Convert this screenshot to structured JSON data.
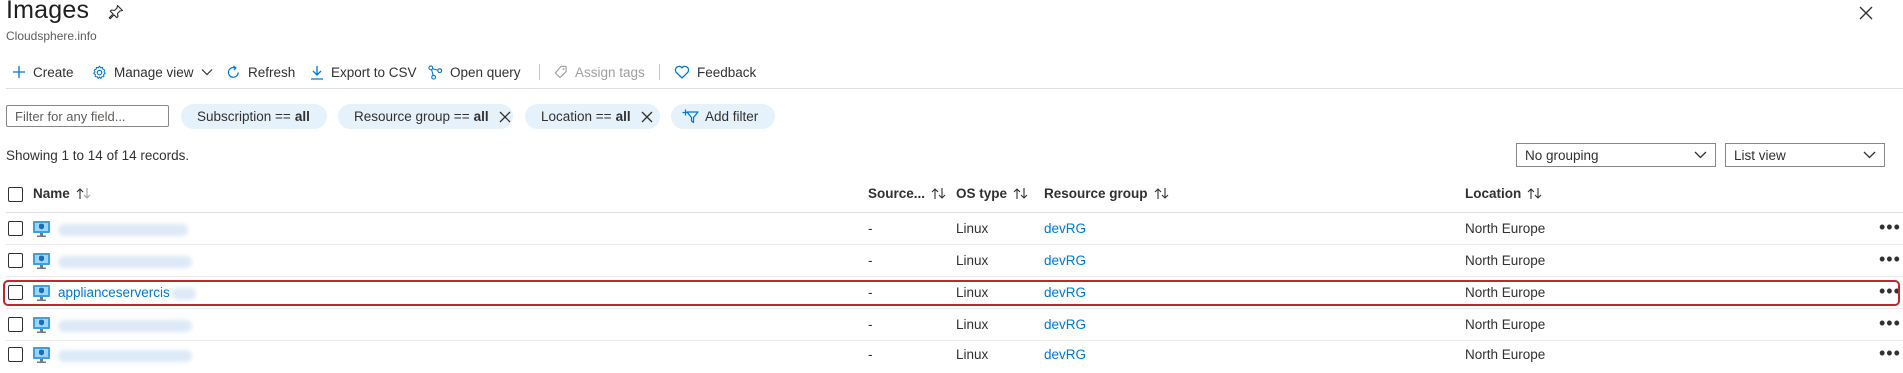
{
  "header": {
    "title": "Images",
    "subtitle": "Cloudsphere.info",
    "pin_icon": "pin-icon",
    "close_icon": "close-icon"
  },
  "toolbar": {
    "create": "Create",
    "manage_view": "Manage view",
    "refresh": "Refresh",
    "export_csv": "Export to CSV",
    "open_query": "Open query",
    "assign_tags": "Assign tags",
    "feedback": "Feedback"
  },
  "filters": {
    "search_placeholder": "Filter for any field...",
    "subscription_label": "Subscription ==",
    "subscription_value": "all",
    "resource_group_label": "Resource group ==",
    "resource_group_value": "all",
    "location_label": "Location ==",
    "location_value": "all",
    "add_filter": "Add filter"
  },
  "records_text": "Showing 1 to 14 of 14 records.",
  "grouping": {
    "selected": "No grouping"
  },
  "view_mode": {
    "selected": "List view"
  },
  "table": {
    "headers": {
      "name": "Name",
      "source": "Source...",
      "os_type": "OS type",
      "resource_group": "Resource group",
      "location": "Location"
    },
    "rows": [
      {
        "name": "",
        "source": "-",
        "os_type": "Linux",
        "resource_group": "devRG",
        "location": "North Europe"
      },
      {
        "name": "",
        "source": "-",
        "os_type": "Linux",
        "resource_group": "devRG",
        "location": "North Europe"
      },
      {
        "name": "applianceservercis",
        "source": "-",
        "os_type": "Linux",
        "resource_group": "devRG",
        "location": "North Europe"
      },
      {
        "name": "",
        "source": "-",
        "os_type": "Linux",
        "resource_group": "devRG",
        "location": "North Europe"
      },
      {
        "name": "",
        "source": "-",
        "os_type": "Linux",
        "resource_group": "devRG",
        "location": "North Europe"
      }
    ],
    "more_icon": "ellipsis-icon"
  },
  "colors": {
    "accent": "#0078d4",
    "pill_bg": "#e5f1fb",
    "highlight": "#c0262d"
  }
}
